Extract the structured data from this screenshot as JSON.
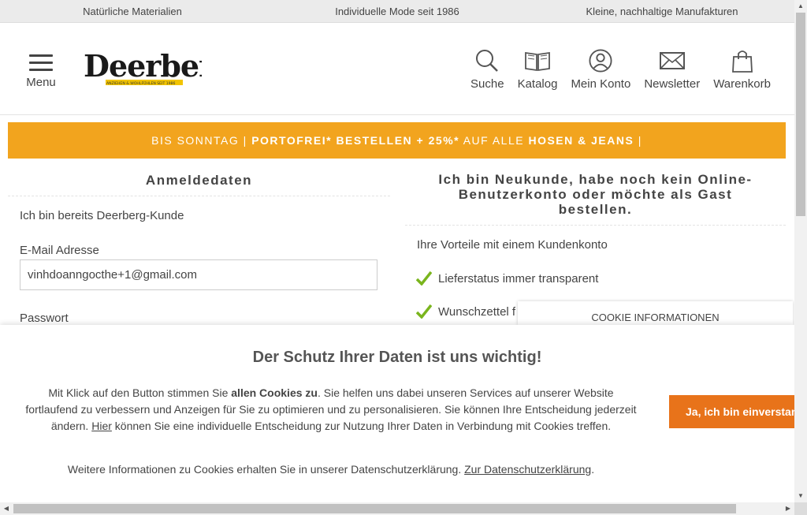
{
  "topbar": {
    "items": [
      "Natürliche Materialien",
      "Individuelle Mode seit 1986",
      "Kleine, nachhaltige Manufakturen"
    ]
  },
  "header": {
    "menu_label": "Menu",
    "logo_text": "Deerberg",
    "logo_tagline": "ANZIEHEN & WOHLFÜHLEN SEIT 1986",
    "nav": [
      {
        "label": "Suche",
        "icon": "search-icon"
      },
      {
        "label": "Katalog",
        "icon": "book-icon"
      },
      {
        "label": "Mein Konto",
        "icon": "user-icon"
      },
      {
        "label": "Newsletter",
        "icon": "envelope-icon"
      },
      {
        "label": "Warenkorb",
        "icon": "bag-icon"
      }
    ]
  },
  "promo": {
    "part1": "BIS SONNTAG | ",
    "part2": "PORTOFREI* BESTELLEN + 25%*",
    "part3": " AUF ALLE ",
    "part4": "HOSEN & JEANS",
    "part5": " |",
    "background": "#f2a41e"
  },
  "login": {
    "title": "Anmeldedaten",
    "subtitle": "Ich bin bereits Deerberg-Kunde",
    "email_label": "E-Mail Adresse",
    "email_value": "vinhdoanngocthe+1@gmail.com",
    "password_label": "Passwort"
  },
  "register": {
    "title": "Ich bin Neukunde, habe noch kein Online-Benutzerkonto oder möchte als Gast bestellen.",
    "benefits_title": "Ihre Vorteile mit einem Kundenkonto",
    "benefits": [
      "Lieferstatus immer transparent",
      "Wunschzettel f"
    ],
    "check_color": "#7ab51d"
  },
  "cookie": {
    "tab_label": "COOKIE INFORMATIONEN",
    "title": "Der Schutz Ihrer Daten ist uns wichtig!",
    "text_pre": "Mit Klick auf den Button stimmen Sie ",
    "text_bold": "allen Cookies zu",
    "text_mid": ". Sie helfen uns dabei unseren Services auf unserer Website fortlaufend zu verbessern und Anzeigen für Sie zu optimieren und zu personalisieren. Sie können Ihre Entscheidung jederzeit ändern. ",
    "text_link": "Hier",
    "text_post": " können Sie eine individuelle Entscheidung zur Nutzung Ihrer Daten in Verbindung mit Cookies treffen.",
    "foot_text": "Weitere Informationen zu Cookies erhalten Sie in unserer Datenschutzerklärung. ",
    "foot_link": "Zur Datenschutzerklärung",
    "foot_end": ".",
    "accept_label": "Ja, ich bin einverstanden",
    "accept_color": "#e8731a"
  }
}
